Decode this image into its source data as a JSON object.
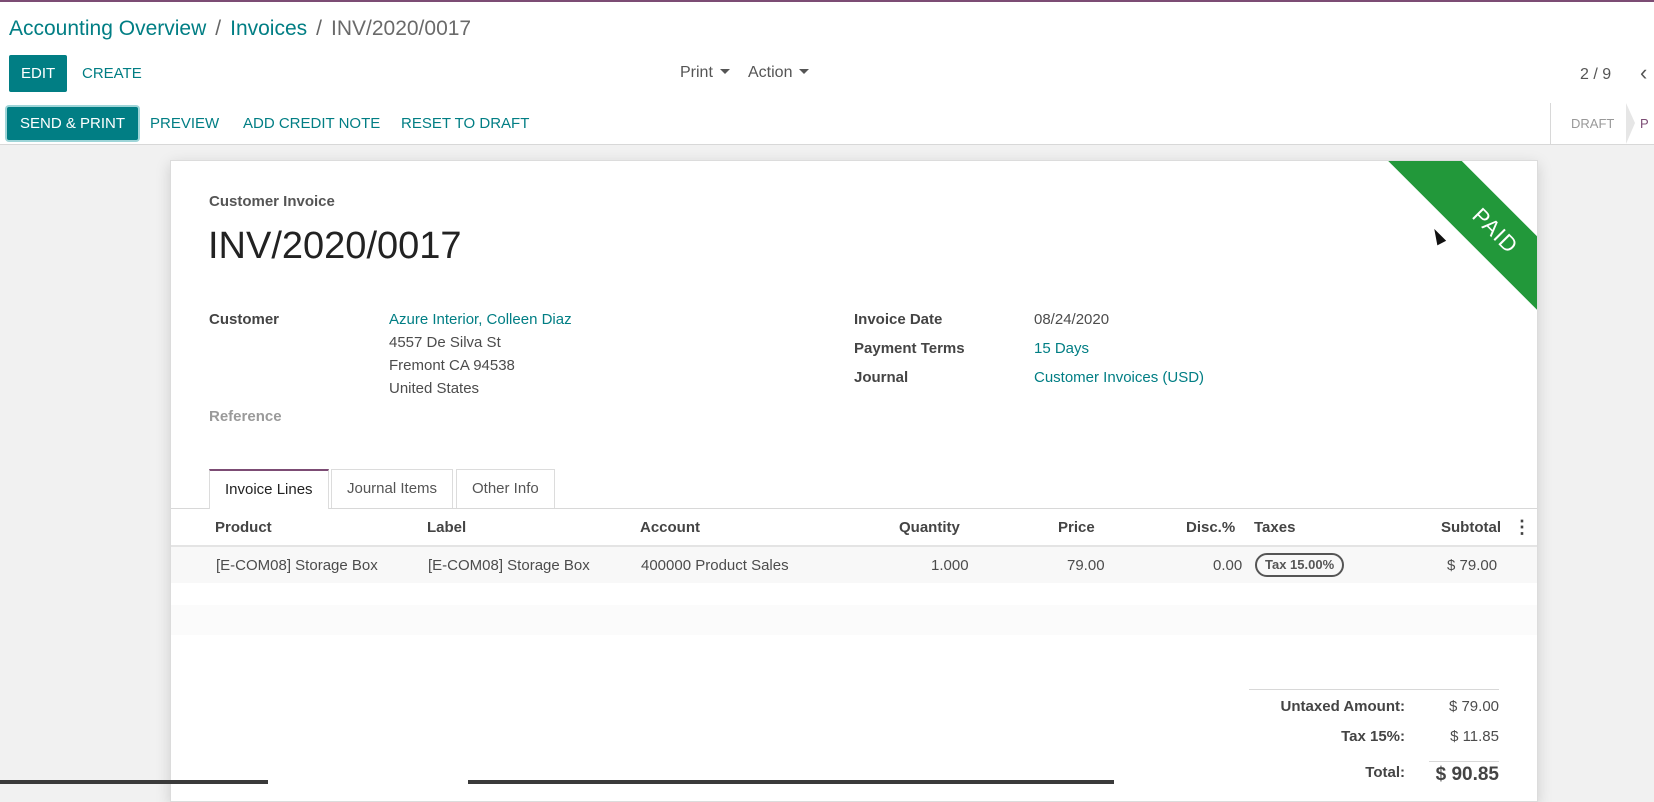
{
  "breadcrumb": {
    "items": [
      "Accounting Overview",
      "Invoices"
    ],
    "separator": "/",
    "current": "INV/2020/0017"
  },
  "toolbar": {
    "edit_label": "EDIT",
    "create_label": "CREATE",
    "print_label": "Print",
    "action_label": "Action",
    "pager": "2 / 9",
    "prev_icon": "chevron-left-icon"
  },
  "statusbar": {
    "send_print_label": "SEND & PRINT",
    "preview_label": "PREVIEW",
    "credit_note_label": "ADD CREDIT NOTE",
    "reset_label": "RESET TO DRAFT",
    "stage_draft": "DRAFT",
    "stage_next_partial": "P"
  },
  "invoice": {
    "doc_type": "Customer Invoice",
    "name": "INV/2020/0017",
    "ribbon": "PAID",
    "customer_label": "Customer",
    "customer_name": "Azure Interior, Colleen Diaz",
    "address_line1": "4557 De Silva St",
    "address_line2": "Fremont CA 94538",
    "address_line3": "United States",
    "reference_label": "Reference",
    "invoice_date_label": "Invoice Date",
    "invoice_date": "08/24/2020",
    "payment_terms_label": "Payment Terms",
    "payment_terms": "15 Days",
    "journal_label": "Journal",
    "journal": "Customer Invoices (USD)"
  },
  "tabs": [
    {
      "label": "Invoice Lines",
      "active": true
    },
    {
      "label": "Journal Items",
      "active": false
    },
    {
      "label": "Other Info",
      "active": false
    }
  ],
  "lines": {
    "headers": [
      "Product",
      "Label",
      "Account",
      "Quantity",
      "Price",
      "Disc.%",
      "Taxes",
      "Subtotal"
    ],
    "rows": [
      {
        "product": "[E-COM08] Storage Box",
        "label": "[E-COM08] Storage Box",
        "account": "400000 Product Sales",
        "quantity": "1.000",
        "price": "79.00",
        "discount": "0.00",
        "taxes": "Tax 15.00%",
        "subtotal": "$ 79.00"
      }
    ],
    "options_icon": "kebab-menu-icon"
  },
  "totals": {
    "untaxed_label": "Untaxed Amount:",
    "untaxed": "$ 79.00",
    "tax_label": "Tax 15%:",
    "tax": "$ 11.85",
    "total_label": "Total:",
    "total": "$ 90.85"
  },
  "colors": {
    "brand": "#017e84",
    "accent": "#7c4c74",
    "paid_ribbon": "#22983a"
  }
}
